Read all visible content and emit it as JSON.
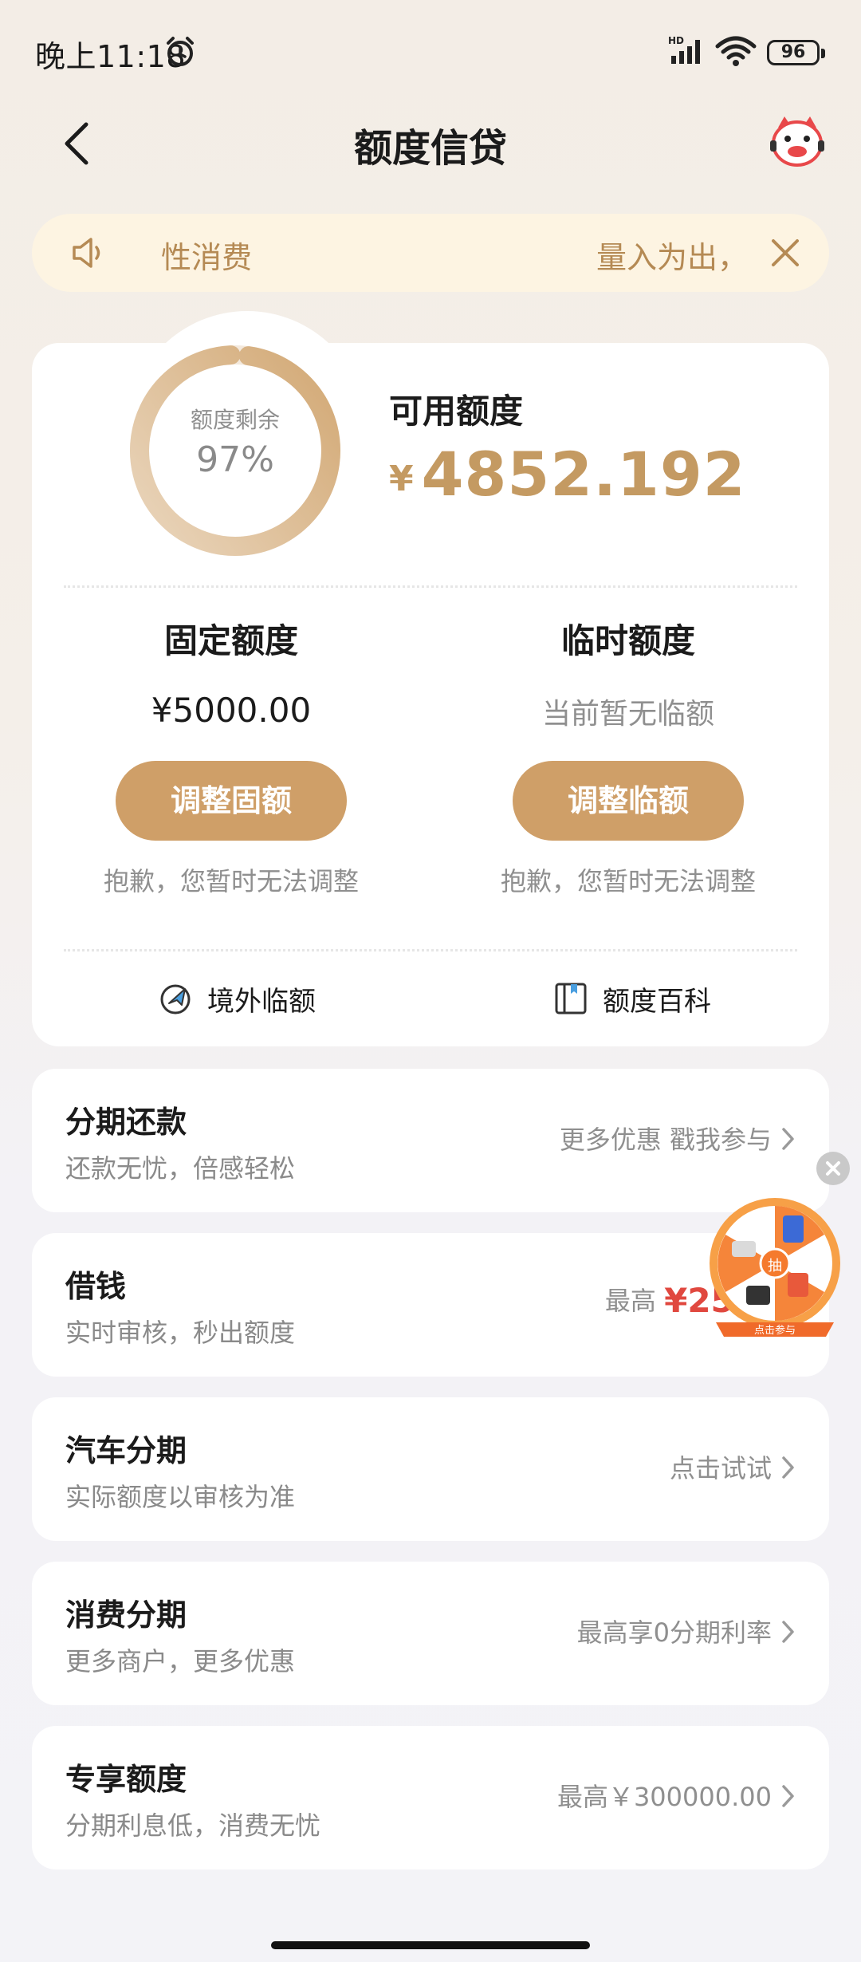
{
  "status_bar": {
    "time": "晚上11:18",
    "battery": "96",
    "icons": [
      "alarm-icon",
      "hd-signal-icon",
      "wifi-icon",
      "battery-icon"
    ]
  },
  "header": {
    "title": "额度信贷",
    "icons": [
      "back-icon",
      "mascot-icon"
    ]
  },
  "notice": {
    "left_text": "性消费",
    "right_text": "量入为出，",
    "icons": [
      "speaker-icon",
      "close-icon"
    ]
  },
  "credit": {
    "ring_label": "额度剩余",
    "ring_value": "97%",
    "remaining_fraction": 0.97,
    "available_label": "可用额度",
    "available_currency": "¥",
    "available_amount": "4852.192",
    "fixed": {
      "title": "固定额度",
      "value": "¥5000.00",
      "button": "调整固额",
      "note": "抱歉，您暂时无法调整"
    },
    "temp": {
      "title": "临时额度",
      "value": "当前暂无临额",
      "button": "调整临额",
      "note": "抱歉，您暂时无法调整"
    },
    "links": [
      {
        "label": "境外临额",
        "icon": "plane-icon"
      },
      {
        "label": "额度百科",
        "icon": "book-icon"
      }
    ]
  },
  "services": [
    {
      "title": "分期还款",
      "subtitle": "还款无忧，倍感轻松",
      "right": "更多优惠 戳我参与",
      "highlight": ""
    },
    {
      "title": "借钱",
      "subtitle": "实时审核，秒出额度",
      "right": "最高",
      "highlight": "¥250"
    },
    {
      "title": "汽车分期",
      "subtitle": "实际额度以审核为准",
      "right": "点击试试",
      "highlight": ""
    },
    {
      "title": "消费分期",
      "subtitle": "更多商户，更多优惠",
      "right": "最高享0分期利率",
      "highlight": ""
    },
    {
      "title": "专享额度",
      "subtitle": "分期利息低，消费无忧",
      "right": "最高￥300000.00",
      "highlight": ""
    }
  ],
  "floating": {
    "center_text": "抽",
    "ribbon_text": "点击参与",
    "icons": [
      "lottery-wheel-icon",
      "close-icon"
    ]
  },
  "colors": {
    "accent_gold": "#cf9f68",
    "amount_gold": "#c49a62",
    "notice_bg": "#fdf4e2",
    "highlight_red": "#e0483f"
  }
}
